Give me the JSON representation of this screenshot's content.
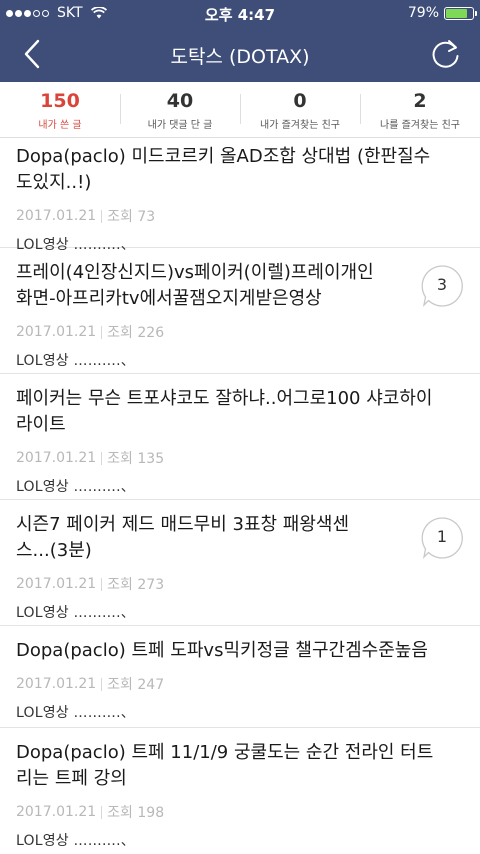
{
  "status_bar": {
    "carrier": "SKT",
    "time": "오후 4:47",
    "battery_text": "79%",
    "battery_level": 0.79
  },
  "header": {
    "title": "도탁스 (DOTAX)",
    "back_icon": "chevron-left-icon",
    "refresh_icon": "refresh-icon"
  },
  "stats": [
    {
      "value": "150",
      "label": "내가 쓴 글",
      "active": true
    },
    {
      "value": "40",
      "label": "내가 댓글 단 글",
      "active": false
    },
    {
      "value": "0",
      "label": "내가 즐겨찾는 친구",
      "active": false
    },
    {
      "value": "2",
      "label": "나를 즐겨찾는 친구",
      "active": false
    }
  ],
  "colors": {
    "nav_bg": "#3e4e78",
    "active_tab": "#d9453a",
    "battery_fill": "#7ed957"
  },
  "posts": [
    {
      "title_line1": "Dopa(paclo) 미드코르키 올AD조합 상대법 (한판질수",
      "title_line2": "도있지..!)",
      "date": "2017.01.21",
      "views_label": "조회 73",
      "board": "LOL영상 ……….、",
      "comments": ""
    },
    {
      "title_line1": "프레이(4인장신지드)vs페이커(이렐)프레이개인",
      "title_line2": "화면-아프리카tv에서꿀잼오지게받은영상",
      "date": "2017.01.21",
      "views_label": "조회 226",
      "board": "LOL영상 ……….、",
      "comments": "3"
    },
    {
      "title_line1": "페이커는 무슨 트포샤코도 잘하냐..어그로100 샤코하이",
      "title_line2": "라이트",
      "date": "2017.01.21",
      "views_label": "조회 135",
      "board": "LOL영상 ……….、",
      "comments": ""
    },
    {
      "title_line1": "시즌7 페이커 제드 매드무비 3표창 패왕색센",
      "title_line2": "스...(3분)",
      "date": "2017.01.21",
      "views_label": "조회 273",
      "board": "LOL영상 ……….、",
      "comments": "1"
    },
    {
      "title_line1": "Dopa(paclo) 트페 도파vs믹키정글 챌구간겜수준높음",
      "title_line2": "",
      "date": "2017.01.21",
      "views_label": "조회 247",
      "board": "LOL영상 ……….、",
      "comments": ""
    },
    {
      "title_line1": "Dopa(paclo) 트페 11/1/9 궁쿨도는 순간 전라인 터트",
      "title_line2": "리는 트페 강의",
      "date": "2017.01.21",
      "views_label": "조회 198",
      "board": "LOL영상 ……….、",
      "comments": ""
    }
  ]
}
